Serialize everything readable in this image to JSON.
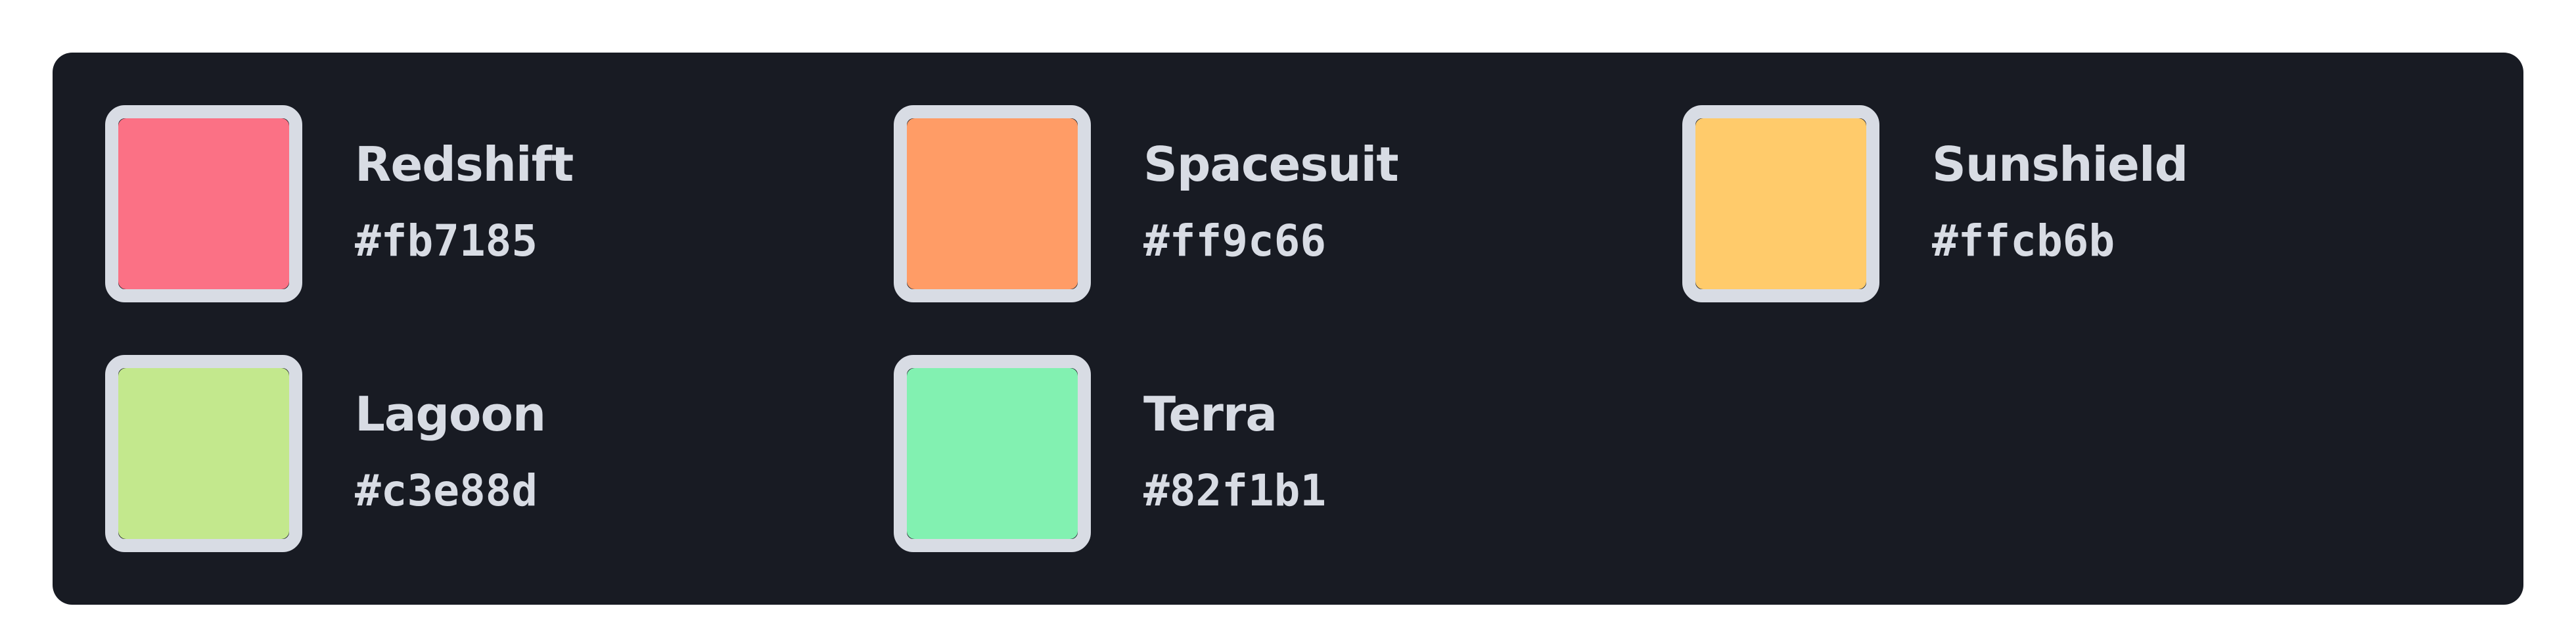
{
  "swatches": [
    {
      "name": "Redshift",
      "hex": "#fb7185"
    },
    {
      "name": "Spacesuit",
      "hex": "#ff9c66"
    },
    {
      "name": "Sunshield",
      "hex": "#ffcb6b"
    },
    {
      "name": "Lagoon",
      "hex": "#c3e88d"
    },
    {
      "name": "Terra",
      "hex": "#82f1b1"
    }
  ],
  "colors": {
    "panel_background": "#181b23",
    "swatch_border": "#d8dce4",
    "text": "#d8dce4"
  }
}
